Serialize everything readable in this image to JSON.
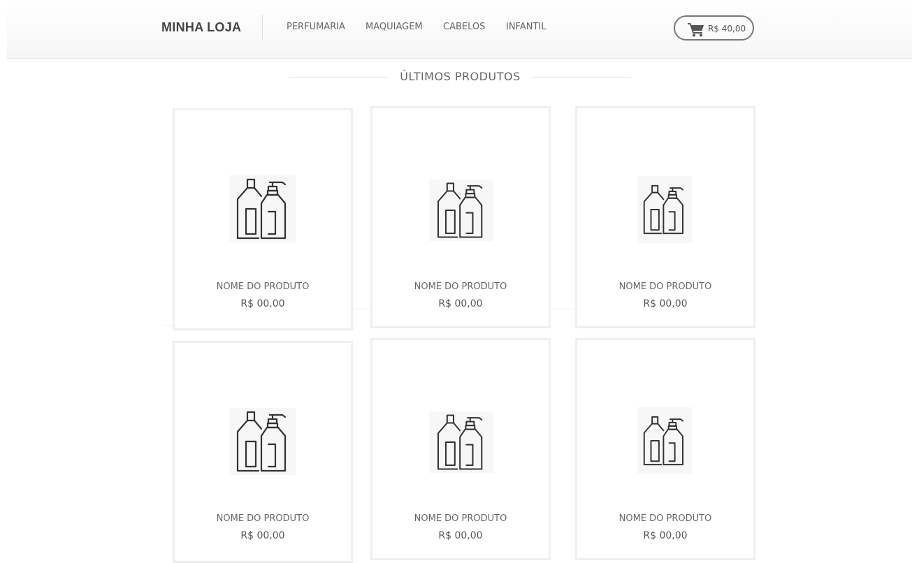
{
  "header": {
    "logo": "MINHA LOJA",
    "nav": [
      {
        "label": "PERFUMARIA"
      },
      {
        "label": "MAQUIAGEM"
      },
      {
        "label": "CABELOS"
      },
      {
        "label": "INFANTIL"
      }
    ],
    "cart": {
      "icon": "shopping-cart-icon",
      "total": "R$ 40,00"
    }
  },
  "section": {
    "title": "ÚLTIMOS PRODUTOS"
  },
  "products": [
    {
      "name": "NOME DO PRODUTO",
      "price": "R$ 00,00",
      "icon": "bottles-icon"
    },
    {
      "name": "NOME DO PRODUTO",
      "price": "R$ 00,00",
      "icon": "bottles-icon"
    },
    {
      "name": "NOME DO PRODUTO",
      "price": "R$ 00,00",
      "icon": "bottles-icon"
    },
    {
      "name": "NOME DO PRODUTO",
      "price": "R$ 00,00",
      "icon": "bottles-icon"
    },
    {
      "name": "NOME DO PRODUTO",
      "price": "R$ 00,00",
      "icon": "bottles-icon"
    },
    {
      "name": "NOME DO PRODUTO",
      "price": "R$ 00,00",
      "icon": "bottles-icon"
    }
  ],
  "colors": {
    "border": "#efefef",
    "text": "#555555"
  }
}
